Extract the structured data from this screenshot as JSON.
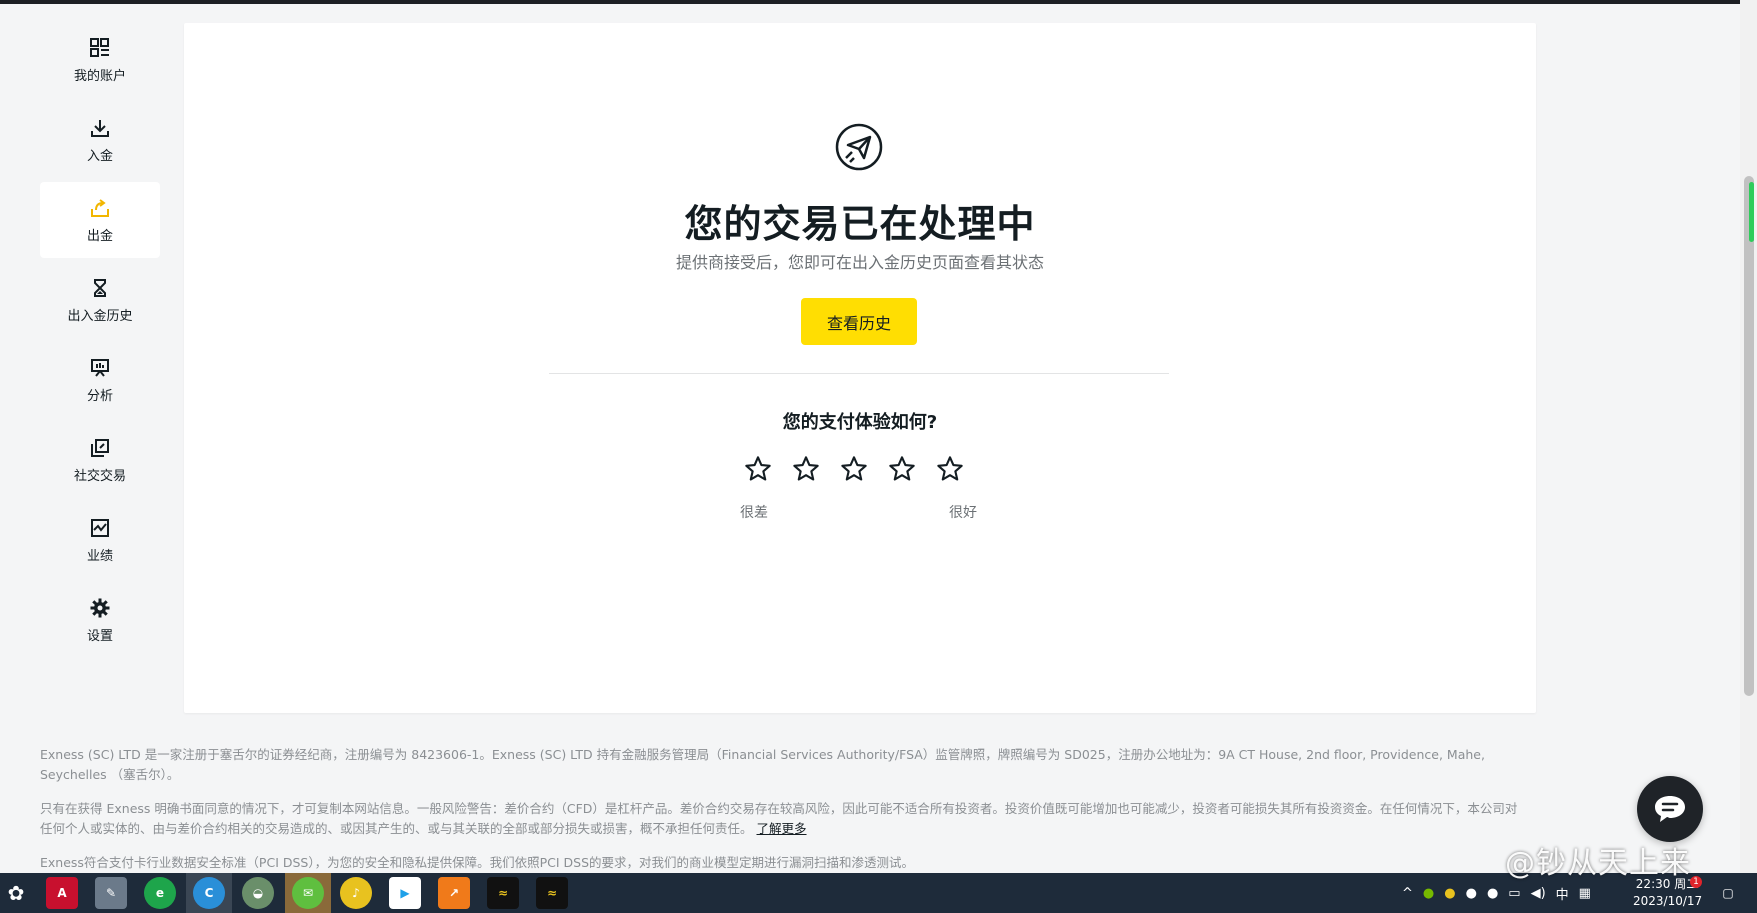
{
  "sidebar": {
    "items": [
      {
        "label": "我的账户",
        "icon": "dashboard-icon"
      },
      {
        "label": "入金",
        "icon": "download-icon"
      },
      {
        "label": "出金",
        "icon": "withdraw-icon"
      },
      {
        "label": "出入金历史",
        "icon": "hourglass-icon"
      },
      {
        "label": "分析",
        "icon": "presentation-icon"
      },
      {
        "label": "社交交易",
        "icon": "copy-trading-icon"
      },
      {
        "label": "业绩",
        "icon": "chart-icon"
      },
      {
        "label": "设置",
        "icon": "gear-icon"
      }
    ],
    "active_index": 2
  },
  "main": {
    "title": "您的交易已在处理中",
    "subtitle": "提供商接受后，您即可在出入金历史页面查看其状态",
    "history_button": "查看历史",
    "rating_title": "您的支付体验如何?",
    "rating_low": "很差",
    "rating_high": "很好",
    "stars": 5
  },
  "footer": {
    "p1": "Exness (SC) LTD 是一家注册于塞舌尔的证券经纪商，注册编号为 8423606-1。Exness (SC) LTD 持有金融服务管理局（Financial Services Authority/FSA）监管牌照，牌照编号为 SD025，注册办公地址为：9A CT House, 2nd floor, Providence, Mahe, Seychelles （塞舌尔）。",
    "p2": "只有在获得 Exness 明确书面同意的情况下，才可复制本网站信息。一般风险警告：差价合约（CFD）是杠杆产品。差价合约交易存在较高风险，因此可能不适合所有投资者。投资价值既可能增加也可能减少，投资者可能损失其所有投资资金。在任何情况下，本公司对任何个人或实体的、由与差价合约相关的交易造成的、或因其产生的、或与其关联的全部或部分损失或损害，概不承担任何责任。",
    "learn_more": "了解更多",
    "p3": "Exness符合支付卡行业数据安全标准（PCI DSS），为您的安全和隐私提供保障。我们依照PCI DSS的要求，对我们的商业模型定期进行漏洞扫描和渗透测试。"
  },
  "watermark": "@钞从天上来",
  "taskbar": {
    "ime": "中",
    "time": "22:30 周二",
    "date": "2023/10/17",
    "notification_badge": "1"
  },
  "colors": {
    "accent": "#ffde02",
    "background": "#f4f5f6",
    "text": "#141d22",
    "taskbar": "#1e2b3a"
  }
}
